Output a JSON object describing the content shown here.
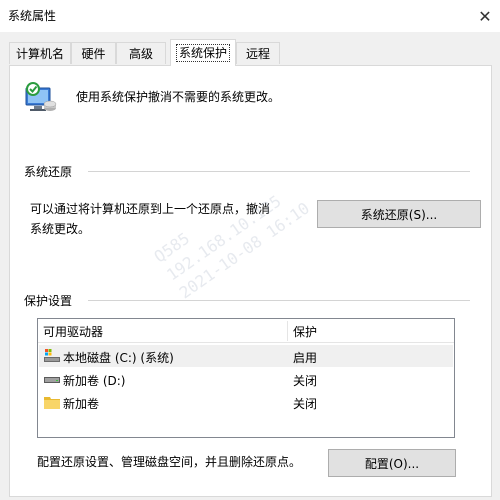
{
  "window": {
    "title": "系统属性",
    "close_glyph": "✕"
  },
  "tabs": [
    {
      "label": "计算机名",
      "active": false
    },
    {
      "label": "硬件",
      "active": false
    },
    {
      "label": "高级",
      "active": false
    },
    {
      "label": "系统保护",
      "active": true
    },
    {
      "label": "远程",
      "active": false
    }
  ],
  "intro": {
    "icon": "system-protection-icon",
    "text": "使用系统保护撤消不需要的系统更改。"
  },
  "system_restore": {
    "group_label": "系统还原",
    "description_line1": "可以通过将计算机还原到上一个还原点，撤消",
    "description_line2": "系统更改。",
    "button_label": "系统还原(S)..."
  },
  "protection_settings": {
    "group_label": "保护设置",
    "columns": [
      "可用驱动器",
      "保护"
    ],
    "drives": [
      {
        "name": "本地磁盘 (C:) (系统)",
        "status": "启用",
        "icon": "system-drive-icon"
      },
      {
        "name": "新加卷 (D:)",
        "status": "关闭",
        "icon": "drive-icon"
      },
      {
        "name": "新加卷",
        "status": "关闭",
        "icon": "folder-icon"
      }
    ]
  },
  "configure": {
    "description": "配置还原设置、管理磁盘空间，并且删除还原点。",
    "button_label": "配置(O)..."
  },
  "watermark": [
    "Q585",
    "192.168.10.125",
    "2021-10-08 16:10"
  ]
}
